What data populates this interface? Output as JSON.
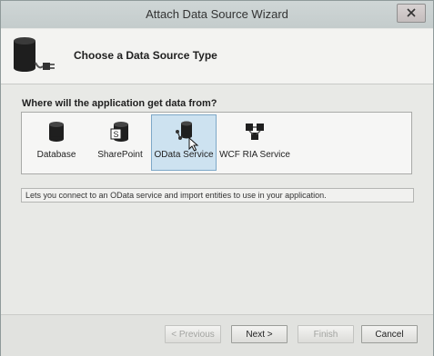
{
  "window": {
    "title": "Attach Data Source Wizard"
  },
  "header": {
    "title": "Choose a Data Source Type",
    "icon": "database-plug-icon"
  },
  "main": {
    "question": "Where will the application get data from?",
    "sources": [
      {
        "label": "Database",
        "icon": "database-icon",
        "selected": false
      },
      {
        "label": "SharePoint",
        "icon": "sharepoint-icon",
        "selected": false
      },
      {
        "label": "OData Service",
        "icon": "odata-service-icon",
        "selected": true
      },
      {
        "label": "WCF RIA Service",
        "icon": "wcf-ria-service-icon",
        "selected": false
      }
    ],
    "description": "Lets you connect to an OData service and import entities to use in your application."
  },
  "footer": {
    "previous_label": "< Previous",
    "next_label": "Next >",
    "finish_label": "Finish",
    "cancel_label": "Cancel"
  },
  "colors": {
    "selection_fill": "#cde2f0",
    "selection_border": "#7ea8c8",
    "titlebar": "#c9d0d0"
  }
}
